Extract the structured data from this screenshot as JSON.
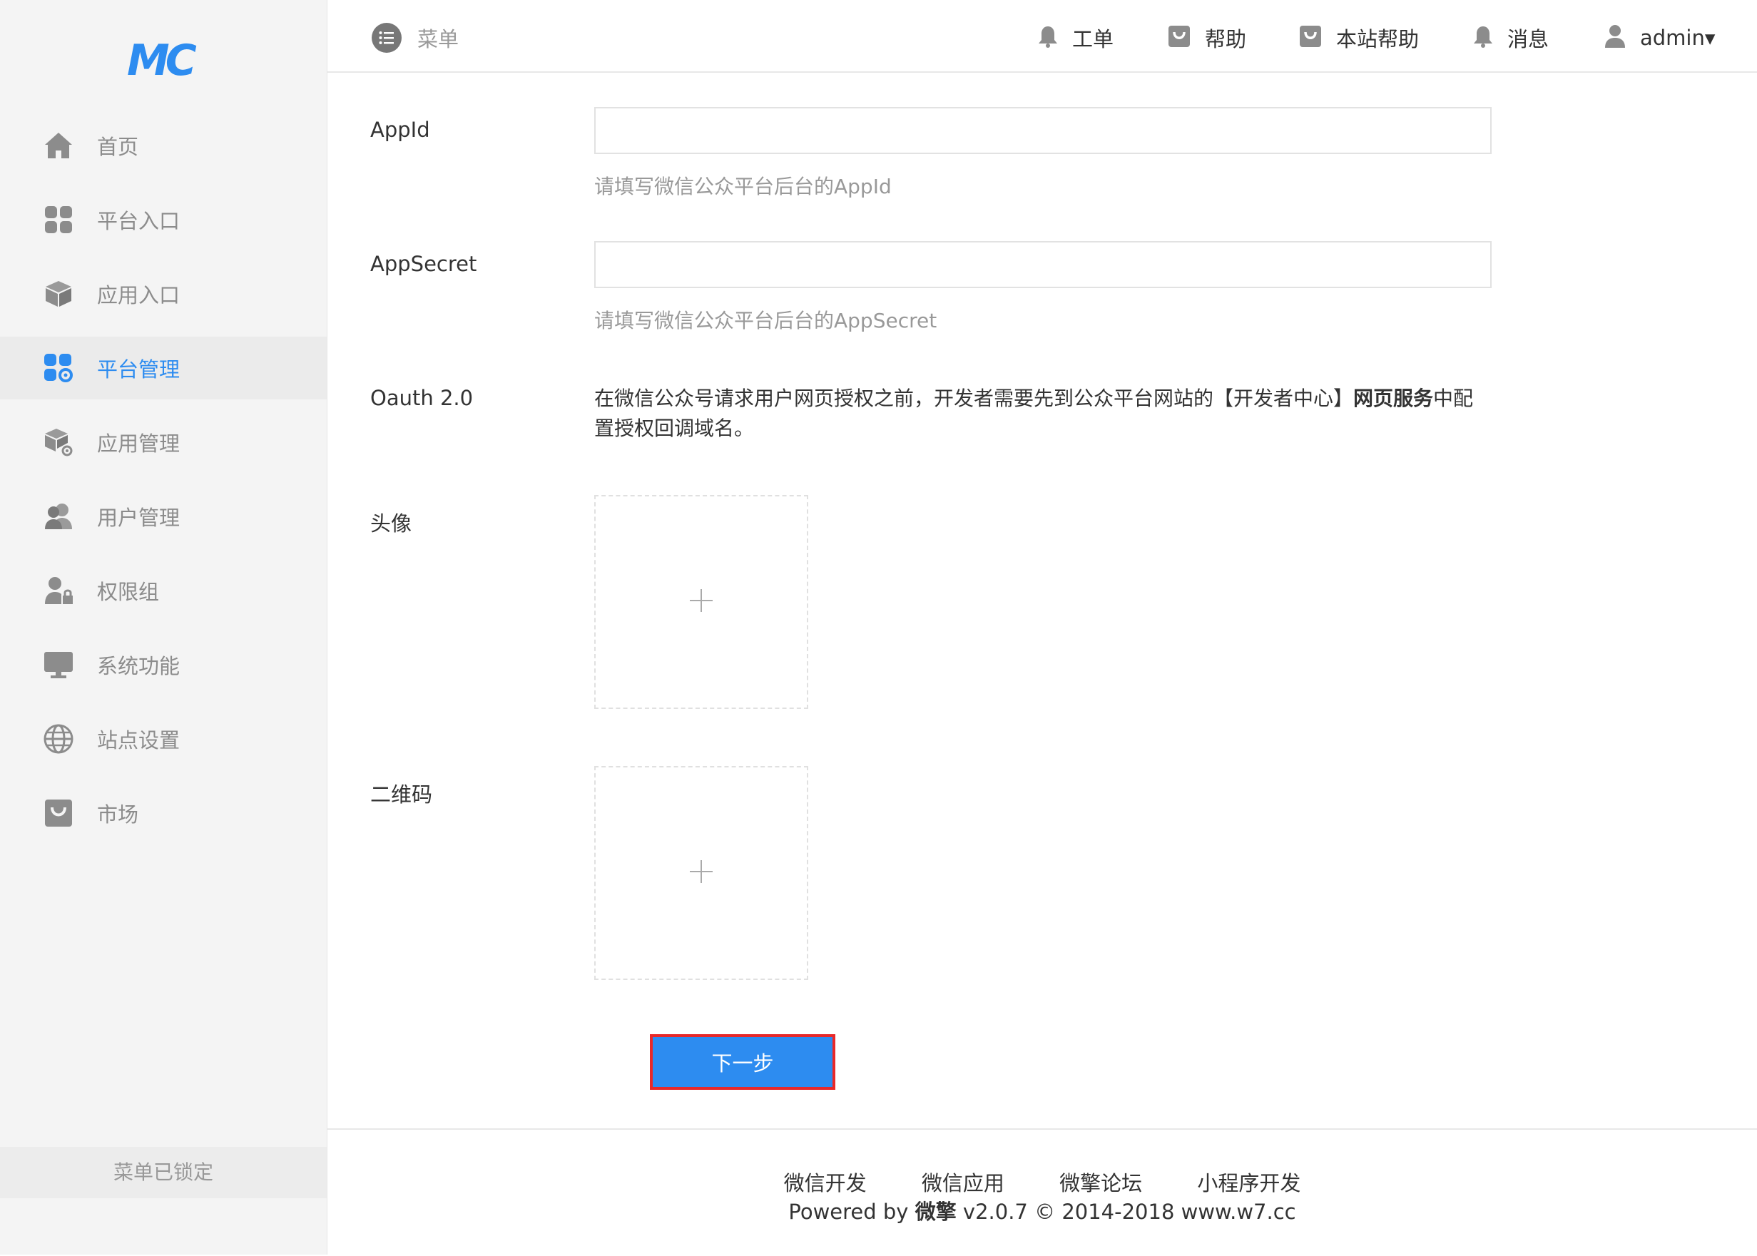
{
  "sidebar": {
    "logo": "MC",
    "items": [
      {
        "label": "首页",
        "icon": "home-icon"
      },
      {
        "label": "平台入口",
        "icon": "grid-icon"
      },
      {
        "label": "应用入口",
        "icon": "box-icon"
      },
      {
        "label": "平台管理",
        "icon": "grid-gear-icon",
        "active": true
      },
      {
        "label": "应用管理",
        "icon": "box-gear-icon"
      },
      {
        "label": "用户管理",
        "icon": "users-icon"
      },
      {
        "label": "权限组",
        "icon": "user-lock-icon"
      },
      {
        "label": "系统功能",
        "icon": "monitor-icon"
      },
      {
        "label": "站点设置",
        "icon": "globe-icon"
      },
      {
        "label": "市场",
        "icon": "bag-icon"
      }
    ],
    "lock_text": "菜单已锁定"
  },
  "header": {
    "menu_label": "菜单",
    "items": [
      {
        "label": "工单",
        "icon": "bell-icon"
      },
      {
        "label": "帮助",
        "icon": "bag-icon"
      },
      {
        "label": "本站帮助",
        "icon": "bag-icon"
      },
      {
        "label": "消息",
        "icon": "bell-icon"
      },
      {
        "label": "admin▾",
        "icon": "user-icon"
      }
    ]
  },
  "form": {
    "appid": {
      "label": "AppId",
      "value": "",
      "help": "请填写微信公众平台后台的AppId"
    },
    "appsecret": {
      "label": "AppSecret",
      "value": "",
      "help": "请填写微信公众平台后台的AppSecret"
    },
    "oauth": {
      "label": "Oauth 2.0",
      "text_before": "在微信公众号请求用户网页授权之前，开发者需要先到公众平台网站的【开发者中心】",
      "text_bold": "网页服务",
      "text_after": "中配置授权回调域名。"
    },
    "avatar": {
      "label": "头像",
      "plus": "+"
    },
    "qrcode": {
      "label": "二维码",
      "plus": "+"
    },
    "next_label": "下一步"
  },
  "footer": {
    "links": [
      "微信开发",
      "微信应用",
      "微擎论坛",
      "小程序开发"
    ],
    "powered_prefix": "Powered by ",
    "powered_brand": "微擎",
    "powered_suffix": " v2.0.7 © 2014-2018 www.w7.cc"
  },
  "colors": {
    "accent": "#2d8cf0",
    "highlight_border": "#e8292a",
    "sidebar_bg": "#f4f4f4",
    "icon_gray": "#8c8c8c"
  }
}
